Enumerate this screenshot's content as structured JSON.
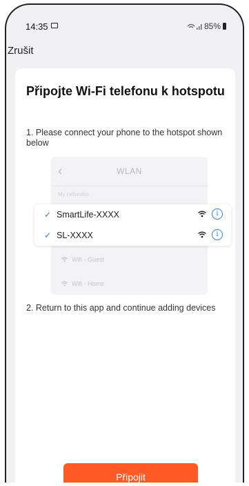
{
  "status_bar": {
    "time": "14:35",
    "battery": "85%"
  },
  "top_bar": {
    "cancel_label": "Zrušit"
  },
  "card": {
    "title": "Připojte Wi-Fi telefonu k hotspotu",
    "step1": "1. Please connect your phone to the hotspot shown below",
    "step2": "2. Return to this app and continue adding devices"
  },
  "illustration": {
    "header_title": "WLAN",
    "section_label": "My networks",
    "connected_networks": [
      "SmartLife-XXXX",
      "SL-XXXX"
    ],
    "other_networks": [
      "Wifi - Guest",
      "Wifi - Home"
    ]
  },
  "connect_button_label": "Připojit",
  "colors": {
    "accent": "#ff5a25",
    "check_blue": "#2d7ce6"
  },
  "icons": [
    "image-icon",
    "wifi-signal-icon",
    "battery-icon",
    "back-chevron-icon",
    "check-icon",
    "wifi-icon",
    "info-icon"
  ]
}
